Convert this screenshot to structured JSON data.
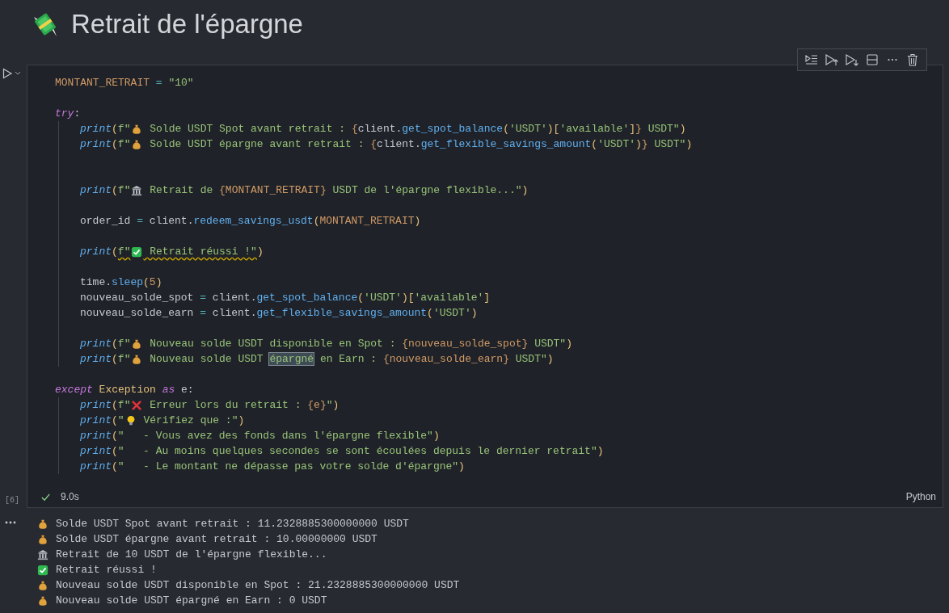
{
  "heading": {
    "title": "Retrait de l'épargne"
  },
  "cell": {
    "execution_count": "[6]",
    "succeeded": true,
    "duration": "9.0s",
    "language": "Python",
    "code": [
      {
        "kind": "code",
        "tokens": [
          {
            "kind": "const",
            "text": "MONTANT_RETRAIT"
          },
          {
            "kind": "op",
            "text": " = "
          },
          {
            "kind": "str",
            "text": "\"10\""
          }
        ]
      },
      {
        "kind": "blank"
      },
      {
        "kind": "code",
        "tokens": [
          {
            "kind": "kw",
            "text": "try"
          },
          {
            "kind": "plain",
            "text": ":"
          }
        ],
        "children": [
          {
            "kind": "code",
            "tokens": [
              {
                "kind": "fn",
                "text": "print"
              },
              {
                "kind": "paren",
                "text": "("
              },
              {
                "kind": "str",
                "text": "f\""
              },
              {
                "kind": "bag"
              },
              {
                "kind": "str",
                "text": " Solde USDT Spot avant retrait : "
              },
              {
                "kind": "brace",
                "text": "{"
              },
              {
                "kind": "plain",
                "text": "client."
              },
              {
                "kind": "method",
                "text": "get_spot_balance"
              },
              {
                "kind": "paren",
                "text": "("
              },
              {
                "kind": "str",
                "text": "'USDT'"
              },
              {
                "kind": "paren",
                "text": ")["
              },
              {
                "kind": "str",
                "text": "'available'"
              },
              {
                "kind": "paren",
                "text": "]"
              },
              {
                "kind": "brace",
                "text": "}"
              },
              {
                "kind": "str",
                "text": " USDT\""
              },
              {
                "kind": "paren",
                "text": ")"
              }
            ]
          },
          {
            "kind": "code",
            "tokens": [
              {
                "kind": "fn",
                "text": "print"
              },
              {
                "kind": "paren",
                "text": "("
              },
              {
                "kind": "str",
                "text": "f\""
              },
              {
                "kind": "bag"
              },
              {
                "kind": "str",
                "text": " Solde USDT épargne avant retrait : "
              },
              {
                "kind": "brace",
                "text": "{"
              },
              {
                "kind": "plain",
                "text": "client."
              },
              {
                "kind": "method",
                "text": "get_flexible_savings_amount"
              },
              {
                "kind": "paren",
                "text": "("
              },
              {
                "kind": "str",
                "text": "'USDT'"
              },
              {
                "kind": "paren",
                "text": ")"
              },
              {
                "kind": "brace",
                "text": "}"
              },
              {
                "kind": "str",
                "text": " USDT\""
              },
              {
                "kind": "paren",
                "text": ")"
              }
            ]
          },
          {
            "kind": "blank"
          },
          {
            "kind": "blank"
          },
          {
            "kind": "code",
            "tokens": [
              {
                "kind": "fn",
                "text": "print"
              },
              {
                "kind": "paren",
                "text": "("
              },
              {
                "kind": "str",
                "text": "f\""
              },
              {
                "kind": "bank"
              },
              {
                "kind": "str",
                "text": " Retrait de "
              },
              {
                "kind": "brace",
                "text": "{MONTANT_RETRAIT}"
              },
              {
                "kind": "str",
                "text": " USDT de l'épargne flexible...\""
              },
              {
                "kind": "paren",
                "text": ")"
              }
            ]
          },
          {
            "kind": "blank"
          },
          {
            "kind": "code",
            "tokens": [
              {
                "kind": "plain",
                "text": "order_id"
              },
              {
                "kind": "op",
                "text": " = "
              },
              {
                "kind": "plain",
                "text": "client."
              },
              {
                "kind": "method",
                "text": "redeem_savings_usdt"
              },
              {
                "kind": "paren",
                "text": "("
              },
              {
                "kind": "const",
                "text": "MONTANT_RETRAIT"
              },
              {
                "kind": "paren",
                "text": ")"
              }
            ]
          },
          {
            "kind": "blank"
          },
          {
            "kind": "code",
            "tokens": [
              {
                "kind": "fn",
                "text": "print"
              },
              {
                "kind": "paren",
                "text": "("
              },
              {
                "kind": "str-warn",
                "text": "f\""
              },
              {
                "kind": "check"
              },
              {
                "kind": "str-warn",
                "text": " Retrait réussi !\""
              },
              {
                "kind": "paren",
                "text": ")"
              }
            ]
          },
          {
            "kind": "blank"
          },
          {
            "kind": "code",
            "tokens": [
              {
                "kind": "plain",
                "text": "time."
              },
              {
                "kind": "method",
                "text": "sleep"
              },
              {
                "kind": "paren",
                "text": "("
              },
              {
                "kind": "num",
                "text": "5"
              },
              {
                "kind": "paren",
                "text": ")"
              }
            ]
          },
          {
            "kind": "code",
            "tokens": [
              {
                "kind": "plain",
                "text": "nouveau_solde_spot"
              },
              {
                "kind": "op",
                "text": " = "
              },
              {
                "kind": "plain",
                "text": "client."
              },
              {
                "kind": "method",
                "text": "get_spot_balance"
              },
              {
                "kind": "paren",
                "text": "("
              },
              {
                "kind": "str",
                "text": "'USDT'"
              },
              {
                "kind": "paren",
                "text": ")["
              },
              {
                "kind": "str",
                "text": "'available'"
              },
              {
                "kind": "paren",
                "text": "]"
              }
            ]
          },
          {
            "kind": "code",
            "tokens": [
              {
                "kind": "plain",
                "text": "nouveau_solde_earn"
              },
              {
                "kind": "op",
                "text": " = "
              },
              {
                "kind": "plain",
                "text": "client."
              },
              {
                "kind": "method",
                "text": "get_flexible_savings_amount"
              },
              {
                "kind": "paren",
                "text": "("
              },
              {
                "kind": "str",
                "text": "'USDT'"
              },
              {
                "kind": "paren",
                "text": ")"
              }
            ]
          },
          {
            "kind": "blank"
          },
          {
            "kind": "code",
            "tokens": [
              {
                "kind": "fn",
                "text": "print"
              },
              {
                "kind": "paren",
                "text": "("
              },
              {
                "kind": "str",
                "text": "f\""
              },
              {
                "kind": "bag"
              },
              {
                "kind": "str",
                "text": " Nouveau solde USDT disponible en Spot : "
              },
              {
                "kind": "brace",
                "text": "{nouveau_solde_spot}"
              },
              {
                "kind": "str",
                "text": " USDT\""
              },
              {
                "kind": "paren",
                "text": ")"
              }
            ]
          },
          {
            "kind": "code",
            "tokens": [
              {
                "kind": "fn",
                "text": "print"
              },
              {
                "kind": "paren",
                "text": "("
              },
              {
                "kind": "str",
                "text": "f\""
              },
              {
                "kind": "bag"
              },
              {
                "kind": "str",
                "text": " Nouveau solde USDT "
              },
              {
                "kind": "str-match",
                "text": "épargné"
              },
              {
                "kind": "str",
                "text": " en Earn : "
              },
              {
                "kind": "brace",
                "text": "{nouveau_solde_earn}"
              },
              {
                "kind": "str",
                "text": " USDT\""
              },
              {
                "kind": "paren",
                "text": ")"
              }
            ]
          }
        ]
      },
      {
        "kind": "blank"
      },
      {
        "kind": "code",
        "tokens": [
          {
            "kind": "kw",
            "text": "except "
          },
          {
            "kind": "cls",
            "text": "Exception "
          },
          {
            "kind": "kw",
            "text": "as"
          },
          {
            "kind": "plain",
            "text": " e:"
          }
        ],
        "children": [
          {
            "kind": "code",
            "tokens": [
              {
                "kind": "fn",
                "text": "print"
              },
              {
                "kind": "paren",
                "text": "("
              },
              {
                "kind": "str",
                "text": "f\""
              },
              {
                "kind": "cross"
              },
              {
                "kind": "str",
                "text": " Erreur lors du retrait : "
              },
              {
                "kind": "brace",
                "text": "{e}"
              },
              {
                "kind": "str",
                "text": "\""
              },
              {
                "kind": "paren",
                "text": ")"
              }
            ]
          },
          {
            "kind": "code",
            "tokens": [
              {
                "kind": "fn",
                "text": "print"
              },
              {
                "kind": "paren",
                "text": "("
              },
              {
                "kind": "str",
                "text": "\""
              },
              {
                "kind": "bulb"
              },
              {
                "kind": "str",
                "text": " Vérifiez que :\""
              },
              {
                "kind": "paren",
                "text": ")"
              }
            ]
          },
          {
            "kind": "code",
            "tokens": [
              {
                "kind": "fn",
                "text": "print"
              },
              {
                "kind": "paren",
                "text": "("
              },
              {
                "kind": "str",
                "text": "\"   - Vous avez des fonds dans l'épargne flexible\""
              },
              {
                "kind": "paren",
                "text": ")"
              }
            ]
          },
          {
            "kind": "code",
            "tokens": [
              {
                "kind": "fn",
                "text": "print"
              },
              {
                "kind": "paren",
                "text": "("
              },
              {
                "kind": "str",
                "text": "\"   - Au moins quelques secondes se sont écoulées depuis le dernier retrait\""
              },
              {
                "kind": "paren",
                "text": ")"
              }
            ]
          },
          {
            "kind": "code",
            "tokens": [
              {
                "kind": "fn",
                "text": "print"
              },
              {
                "kind": "paren",
                "text": "("
              },
              {
                "kind": "str",
                "text": "\"   - Le montant ne dépasse pas votre solde d'épargne\""
              },
              {
                "kind": "paren",
                "text": ")"
              }
            ]
          }
        ]
      }
    ],
    "output": [
      {
        "kind": "bag",
        "text": "Solde USDT Spot avant retrait : 11.2328885300000000 USDT"
      },
      {
        "kind": "bag",
        "text": "Solde USDT épargne avant retrait : 10.00000000 USDT"
      },
      {
        "kind": "bank",
        "text": "Retrait de 10 USDT de l'épargne flexible..."
      },
      {
        "kind": "check",
        "text": "Retrait réussi !"
      },
      {
        "kind": "bag",
        "text": "Nouveau solde USDT disponible en Spot : 21.2328885300000000 USDT"
      },
      {
        "kind": "bag",
        "text": "Nouveau solde USDT épargné en Earn : 0 USDT"
      }
    ]
  }
}
